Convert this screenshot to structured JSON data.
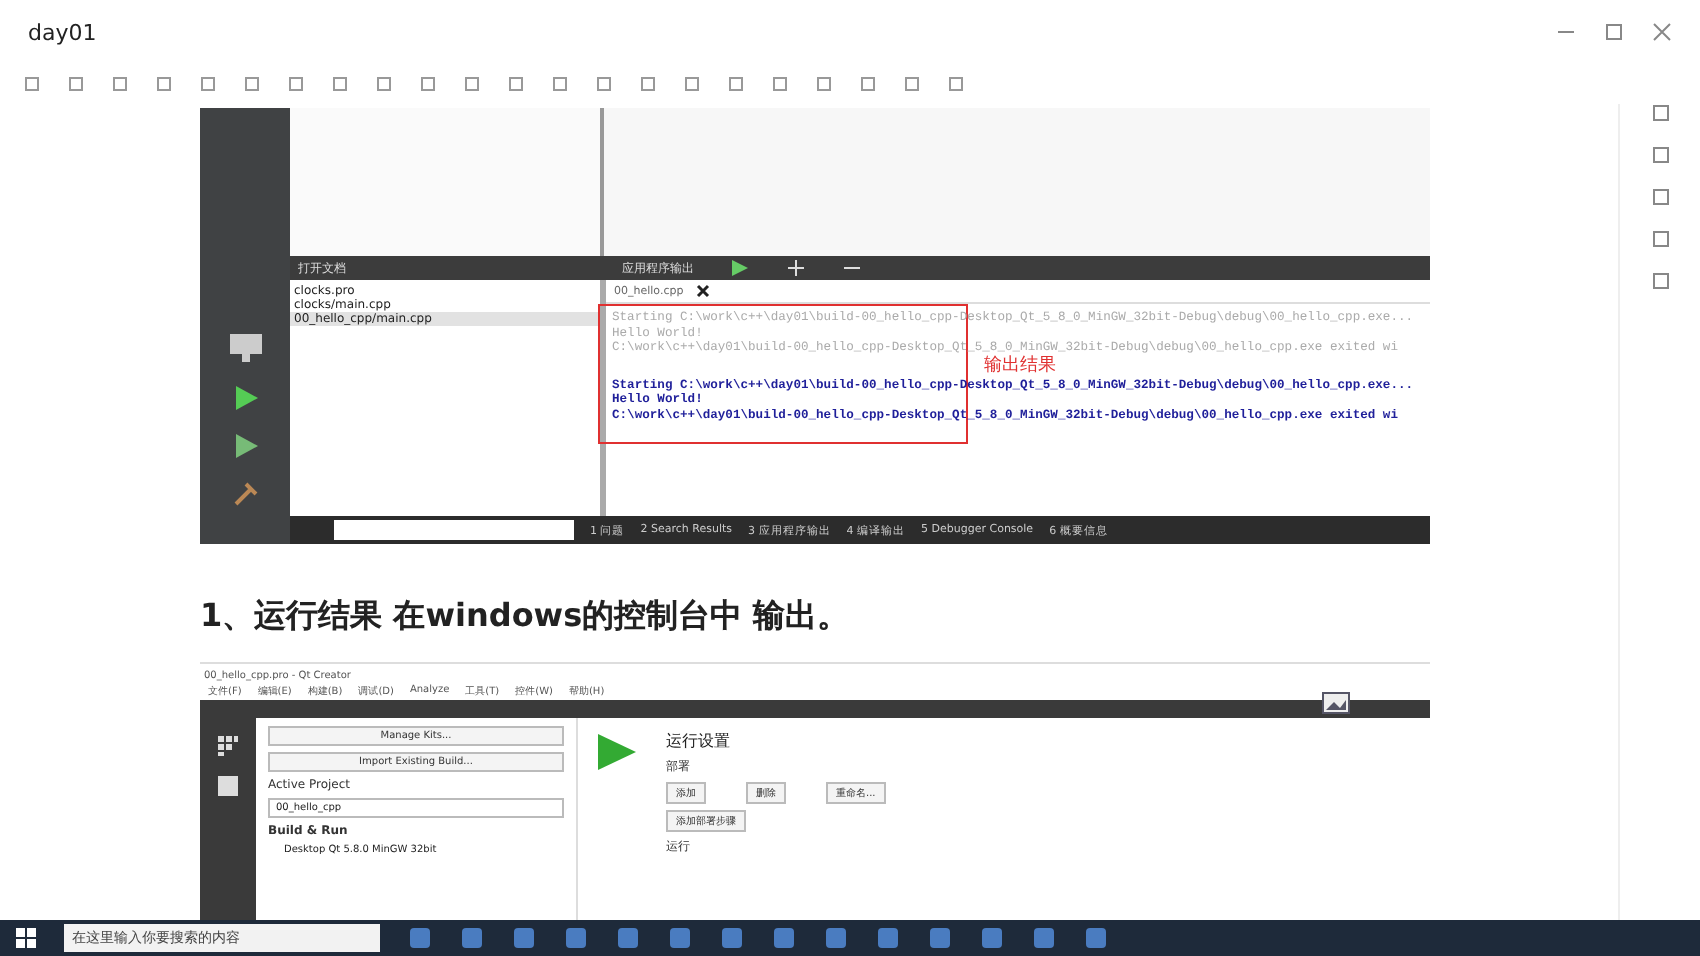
{
  "window": {
    "title": "day01"
  },
  "qt_output_shot": {
    "open_docs_title": "打开文档",
    "output_title": "应用程序输出",
    "files": [
      {
        "name": "clocks.pro",
        "selected": false
      },
      {
        "name": "clocks/main.cpp",
        "selected": false
      },
      {
        "name": "00_hello_cpp/main.cpp",
        "selected": true
      }
    ],
    "tab": "00_hello.cpp",
    "output_lines": [
      {
        "kind": "old",
        "text": "Starting C:\\work\\c++\\day01\\build-00_hello_cpp-Desktop_Qt_5_8_0_MinGW_32bit-Debug\\debug\\00_hello_cpp.exe..."
      },
      {
        "kind": "old",
        "text": "Hello World!"
      },
      {
        "kind": "old",
        "text": "C:\\work\\c++\\day01\\build-00_hello_cpp-Desktop_Qt_5_8_0_MinGW_32bit-Debug\\debug\\00_hello_cpp.exe exited wi"
      },
      {
        "kind": "new",
        "text": "Starting C:\\work\\c++\\day01\\build-00_hello_cpp-Desktop_Qt_5_8_0_MinGW_32bit-Debug\\debug\\00_hello_cpp.exe..."
      },
      {
        "kind": "new",
        "text": "Hello World!"
      },
      {
        "kind": "new",
        "text": "C:\\work\\c++\\day01\\build-00_hello_cpp-Desktop_Qt_5_8_0_MinGW_32bit-Debug\\debug\\00_hello_cpp.exe exited wi"
      }
    ],
    "annotation": "输出结果",
    "pane_tabs": [
      "1 问题",
      "2 Search Results",
      "3 应用程序输出",
      "4 编译输出",
      "5 Debugger Console",
      "6 概要信息"
    ]
  },
  "heading": "1、运行结果 在windows的控制台中 输出。",
  "qt_settings_shot": {
    "title": "00_hello_cpp.pro - Qt Creator",
    "menu": [
      "文件(F)",
      "编辑(E)",
      "构建(B)",
      "调试(D)",
      "Analyze",
      "工具(T)",
      "控件(W)",
      "帮助(H)"
    ],
    "buttons": [
      "Manage Kits...",
      "Import Existing Build..."
    ],
    "active_project_label": "Active Project",
    "project": "00_hello_cpp",
    "build_run_label": "Build & Run",
    "kit": "Desktop Qt 5.8.0 MinGW 32bit",
    "settings_title": "运行设置",
    "deploy_label": "部署",
    "add": "添加",
    "remove": "删除",
    "rename": "重命名...",
    "deploy_step": "添加部署步骤",
    "run_label": "运行"
  },
  "taskbar": {
    "search_placeholder": "在这里输入你要搜索的内容"
  }
}
